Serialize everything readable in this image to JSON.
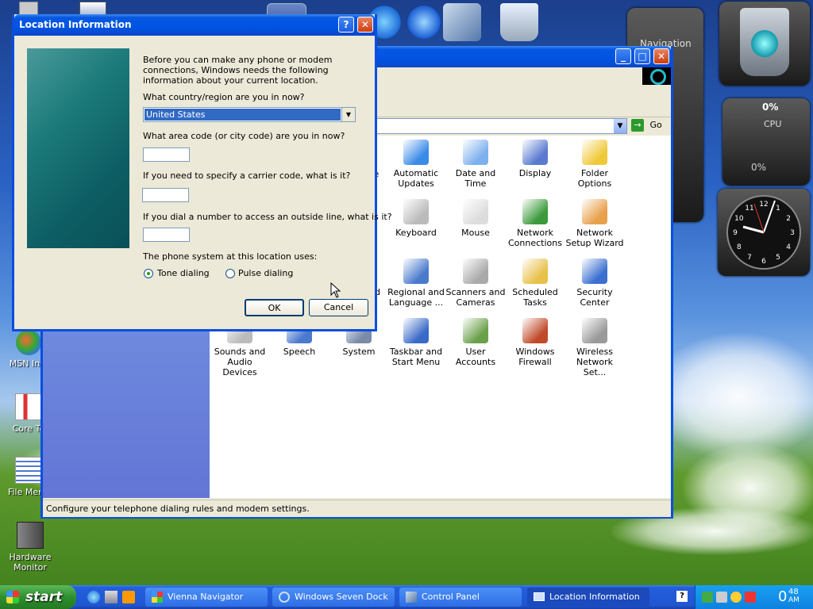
{
  "desktop": {
    "icons": [
      {
        "label": "MSN Inst"
      },
      {
        "label": "Core Te"
      },
      {
        "label": "File Menu"
      },
      {
        "label": "Hardware Monitor"
      }
    ]
  },
  "gadgets": {
    "navigation_label": "Navigation",
    "cpu": {
      "title_value": "0%",
      "label": "CPU",
      "value2": "0%"
    },
    "clock_numbers": [
      "12",
      "1",
      "2",
      "3",
      "4",
      "5",
      "6",
      "7",
      "8",
      "9",
      "10",
      "11"
    ]
  },
  "control_panel": {
    "address_go": "Go",
    "status_text": "Configure your telephone dialing rules and modem settings.",
    "items": [
      {
        "label": "Automatic Updates"
      },
      {
        "label": "Date and Time"
      },
      {
        "label": "Display"
      },
      {
        "label": "Folder Options"
      },
      {
        "label": "Keyboard"
      },
      {
        "label": "Mouse"
      },
      {
        "label": "Network Connections"
      },
      {
        "label": "Network Setup Wizard"
      },
      {
        "label": "Regional and Language ..."
      },
      {
        "label": "Scanners and Cameras"
      },
      {
        "label": "Scheduled Tasks"
      },
      {
        "label": "Security Center"
      },
      {
        "label": "Sounds and Audio Devices"
      },
      {
        "label": "Speech"
      },
      {
        "label": "System"
      },
      {
        "label": "Taskbar and Start Menu"
      },
      {
        "label": "User Accounts"
      },
      {
        "label": "Windows Firewall"
      },
      {
        "label": "Wireless Network Set..."
      }
    ],
    "partial_labels": {
      "ve": "ve",
      "d": "d"
    }
  },
  "dialog": {
    "title": "Location Information",
    "intro": "Before you can make any phone or modem connections, Windows needs the following information about your current location.",
    "country_label": "What country/region are you in now?",
    "country_value": "United States",
    "area_label": "What area code (or city code) are you in now?",
    "carrier_label": "If you need to specify a carrier code, what is it?",
    "outside_label": "If you dial a number to access an outside line, what is it?",
    "phone_system_label": "The phone system at this location uses:",
    "tone_label": "Tone dialing",
    "pulse_label": "Pulse dialing",
    "ok_label": "OK",
    "cancel_label": "Cancel"
  },
  "taskbar": {
    "start_label": "start",
    "items": [
      {
        "label": "Vienna Navigator"
      },
      {
        "label": "Windows Seven Dock"
      },
      {
        "label": "Control Panel"
      },
      {
        "label": "Location Information"
      }
    ],
    "clock_hour": "0",
    "clock_min": "48",
    "clock_ampm": "AM"
  }
}
